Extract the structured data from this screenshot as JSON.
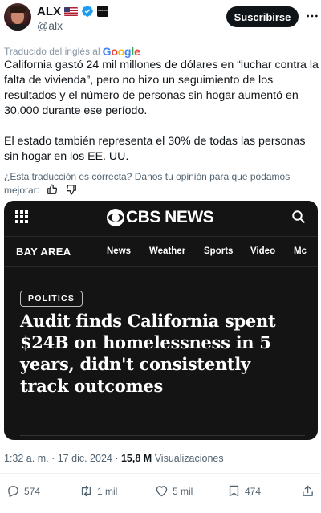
{
  "author": {
    "display_name": "ALX",
    "handle": "@alx",
    "badge_text": "AFFILIATE"
  },
  "subscribe_label": "Suscribirse",
  "translation": {
    "label": "Traducido del inglés al",
    "provider_letters": [
      "G",
      "o",
      "o",
      "g",
      "l",
      "e"
    ]
  },
  "tweet": {
    "paragraphs": [
      "California gastó 24 mil millones de dólares en “luchar contra la falta de vivienda”, pero no hizo un seguimiento de los resultados y el número de personas sin hogar aumentó en 30.000 durante ese período.",
      "El estado también representa el 30% de todas las personas sin hogar en los EE. UU."
    ],
    "feedback_text": "¿Esta traducción es correcta? Danos tu opinión para que podamos mejorar:"
  },
  "card": {
    "logo_text": "CBS NEWS",
    "section": "BAY AREA",
    "nav": [
      "News",
      "Weather",
      "Sports",
      "Video",
      "Mc"
    ],
    "tag": "POLITICS",
    "headline": "Audit finds California spent $24B on homelessness in 5 years, didn't consistently track outcomes"
  },
  "meta": {
    "time": "1:32 a. m.",
    "separator": "·",
    "date": "17 dic. 2024",
    "views_count": "15,8 M",
    "views_label": "Visualizaciones"
  },
  "actions": {
    "replies": "574",
    "reposts": "1 mil",
    "likes": "5 mil",
    "bookmarks": "474"
  },
  "colors": {
    "verified_blue": "#1d9bf0",
    "text_primary": "#0f1419",
    "text_secondary": "#536471",
    "card_background": "#141414"
  },
  "icons": [
    "avatar",
    "us-flag-icon",
    "verified-icon",
    "affiliate-badge-icon",
    "more-icon",
    "thumbs-up-icon",
    "thumbs-down-icon",
    "grid-menu-icon",
    "cbs-eye-icon",
    "search-icon",
    "reply-icon",
    "repost-icon",
    "like-icon",
    "bookmark-icon",
    "share-icon"
  ]
}
